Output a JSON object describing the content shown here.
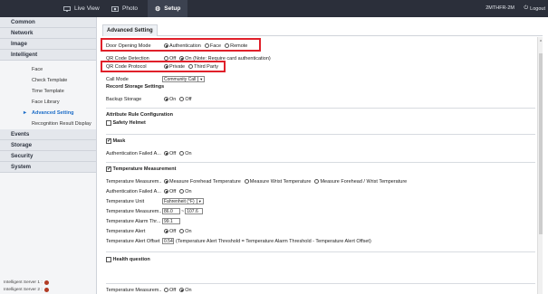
{
  "topbar": {
    "live_view": "Live View",
    "photo": "Photo",
    "setup": "Setup",
    "user": "2MTHFR-2M",
    "logout": "Logout"
  },
  "sidebar": {
    "sections": [
      "Common",
      "Network",
      "Image",
      "Intelligent",
      "Events",
      "Storage",
      "Security",
      "System"
    ],
    "intelligent_items": [
      "Face",
      "Check Template",
      "Time Template",
      "Face Library",
      "Advanced Setting",
      "Recognition Result Display"
    ],
    "active_item": "Advanced Setting",
    "servers": [
      "Intelligent Server 1 :",
      "Intelligent Server 2 :"
    ]
  },
  "content": {
    "tab": "Advanced Setting",
    "door_opening_mode": {
      "label": "Door Opening Mode",
      "options": [
        "Authentication",
        "Face",
        "Remote"
      ],
      "selected": "Authentication"
    },
    "qr_code_detection": {
      "label": "QR Code Detection",
      "options": [
        "Off",
        "On (Note: Require card authentication)"
      ],
      "selected": "On (Note: Require card authentication)"
    },
    "qr_code_protocol": {
      "label": "QR Code Protocol",
      "options": [
        "Private",
        "Third Party"
      ],
      "selected": "Private"
    },
    "call_mode": {
      "label": "Call Mode",
      "value": "Community Call"
    },
    "record_storage": {
      "title": "Record Storage Settings",
      "label": "Backup Storage",
      "options": [
        "On",
        "Off"
      ],
      "selected": "On"
    },
    "attribute_rule": {
      "title": "Attribute Rule Configuration"
    },
    "safety_helmet": {
      "label": "Safety Helmet",
      "checked": false
    },
    "mask": {
      "label": "Mask",
      "checked": true,
      "auth_failed_label": "Authentication Failed A...",
      "options": [
        "Off",
        "On"
      ],
      "selected": "Off"
    },
    "temperature": {
      "label": "Temperature Measurement",
      "checked": true,
      "mode_label": "Temperature Measurem...",
      "mode_options": [
        "Measure Forehead Temperature",
        "Measure Wrist Temperature",
        "Measure Forehead / Wrist Temperature"
      ],
      "mode_selected": "Measure Forehead Temperature",
      "auth_failed_label": "Authentication Failed A...",
      "auth_failed_options": [
        "Off",
        "On"
      ],
      "auth_failed_selected": "Off",
      "unit_label": "Temperature Unit",
      "unit_value": "Fahrenheit (°F)",
      "range_label": "Temperature Measurem...",
      "range_min": "86.0",
      "range_sep": "~",
      "range_max": "107.6",
      "alarm_threshold_label": "Temperature Alarm Thr...",
      "alarm_threshold_value": "99.1",
      "alert_label": "Temperature Alert",
      "alert_options": [
        "Off",
        "On"
      ],
      "alert_selected": "Off",
      "offset_label": "Temperature Alert Offset",
      "offset_value": "0.54",
      "offset_note": "(Temperature Alert Threshold = Temperature Alarm Threshold - Temperature Alert Offset)"
    },
    "health_question": {
      "label": "Health question",
      "checked": false
    },
    "bottom_row": {
      "label": "Temperature Measurem...",
      "options": [
        "Off",
        "On"
      ],
      "selected": "On"
    }
  }
}
